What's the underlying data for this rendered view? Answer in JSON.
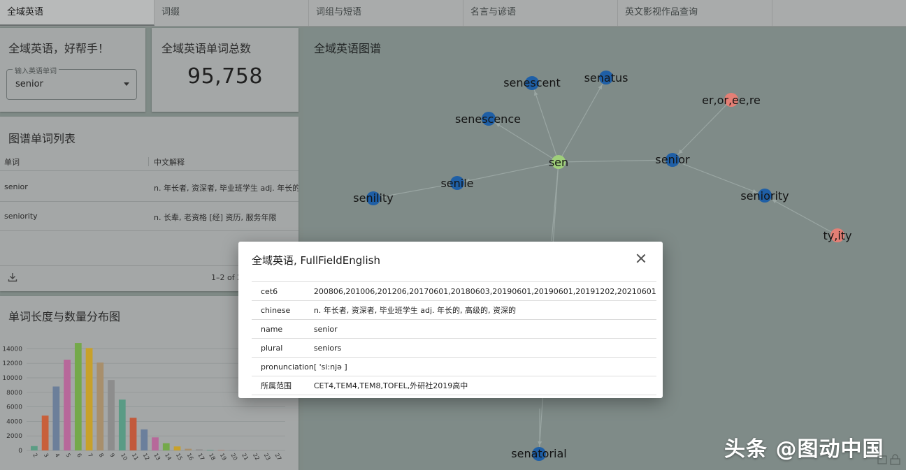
{
  "tabs": [
    {
      "label": "全域英语"
    },
    {
      "label": "词缀"
    },
    {
      "label": "词组与短语"
    },
    {
      "label": "名言与谚语"
    },
    {
      "label": "英文影视作品查询"
    }
  ],
  "search_card": {
    "title": "全域英语，好帮手！",
    "field_label": "输入英语单词",
    "field_value": "senior"
  },
  "count_card": {
    "title": "全域英语单词总数",
    "value": "95,758"
  },
  "word_list": {
    "title": "图谱单词列表",
    "columns": [
      "单词",
      "中文解释"
    ],
    "rows": [
      {
        "word": "senior",
        "meaning": "n. 年长者, 资深者, 毕业班学生 adj. 年长的"
      },
      {
        "word": "seniority",
        "meaning": "n. 长辈, 老资格 [经] 资历, 服务年限"
      }
    ],
    "pager": "1–2 of 2",
    "download_icon": "download-icon"
  },
  "distribution": {
    "title": "单词长度与数量分布图"
  },
  "chart_data": {
    "type": "bar",
    "title": "单词长度与数量分布图",
    "categories": [
      "2",
      "3",
      "4",
      "5",
      "6",
      "7",
      "8",
      "9",
      "10",
      "11",
      "12",
      "13",
      "14",
      "15",
      "16",
      "17",
      "18",
      "19",
      "20",
      "21",
      "22",
      "23",
      "27"
    ],
    "values": [
      600,
      4800,
      8800,
      12500,
      14800,
      14100,
      12100,
      9700,
      7000,
      4500,
      2900,
      1800,
      1000,
      550,
      230,
      150,
      80,
      40,
      20,
      15,
      10,
      5,
      5
    ],
    "colors": [
      "#5b9d84",
      "#c8603b",
      "#6c7f9a",
      "#b7689a",
      "#74a94a",
      "#c8a12a",
      "#a88f6c",
      "#8d8d8d",
      "#5a9b85",
      "#c25a3c",
      "#6b7f9c",
      "#b7689a",
      "#74a94a",
      "#c8a12a",
      "#a88f6c",
      "#8d8d8d",
      "#5a9b85",
      "#c25a3c",
      "#6b7f9c",
      "#b7689a",
      "#74a94a",
      "#c8a12a",
      "#a88f6c"
    ],
    "yticks": [
      0,
      2000,
      4000,
      6000,
      8000,
      10000,
      12000,
      14000
    ],
    "ylim": [
      0,
      15000
    ],
    "grid": true
  },
  "graph": {
    "title": "全域英语图谱",
    "nodes": [
      {
        "id": "sen",
        "label": "sen",
        "color": "#9fcf7a"
      },
      {
        "id": "senior",
        "label": "senior",
        "color": "#1f5fa6"
      },
      {
        "id": "senescent",
        "label": "senescent",
        "color": "#1f5fa6"
      },
      {
        "id": "senatus",
        "label": "senatus",
        "color": "#1f5fa6"
      },
      {
        "id": "senescence",
        "label": "senescence",
        "color": "#1f5fa6"
      },
      {
        "id": "senile",
        "label": "senile",
        "color": "#1f5fa6"
      },
      {
        "id": "senility",
        "label": "senility",
        "color": "#1f5fa6"
      },
      {
        "id": "seniority",
        "label": "seniority",
        "color": "#1f5fa6"
      },
      {
        "id": "er",
        "label": "er,or,ee,re",
        "color": "#e47f75"
      },
      {
        "id": "ty",
        "label": "ty,ity",
        "color": "#e47f75"
      },
      {
        "id": "senatorial",
        "label": "senatorial",
        "color": "#1f5fa6"
      }
    ],
    "edges": [
      [
        "sen",
        "senescent"
      ],
      [
        "sen",
        "senatus"
      ],
      [
        "sen",
        "senescence"
      ],
      [
        "sen",
        "senile"
      ],
      [
        "senile",
        "senility"
      ],
      [
        "sen",
        "senior"
      ],
      [
        "er",
        "senior"
      ],
      [
        "senior",
        "seniority"
      ],
      [
        "ty",
        "seniority"
      ],
      [
        "sen",
        "senatorial"
      ]
    ]
  },
  "dialog": {
    "title": "全域英语, FullFieldEnglish",
    "rows": [
      {
        "key": "cet6",
        "value": "200806,201006,201206,20170601,20180603,20190601,20190601,20191202,20210601"
      },
      {
        "key": "chinese",
        "value": "n. 年长者, 资深者, 毕业班学生 adj. 年长的, 高级的, 资深的"
      },
      {
        "key": "name",
        "value": "senior"
      },
      {
        "key": "plural",
        "value": "seniors"
      },
      {
        "key": "pronunciation",
        "value": "[ 'si:njə ]"
      },
      {
        "key": "所属范围",
        "value": "CET4,TEM4,TEM8,TOFEL,外研社2019高中"
      }
    ]
  },
  "watermark": "头条 @图动中国"
}
